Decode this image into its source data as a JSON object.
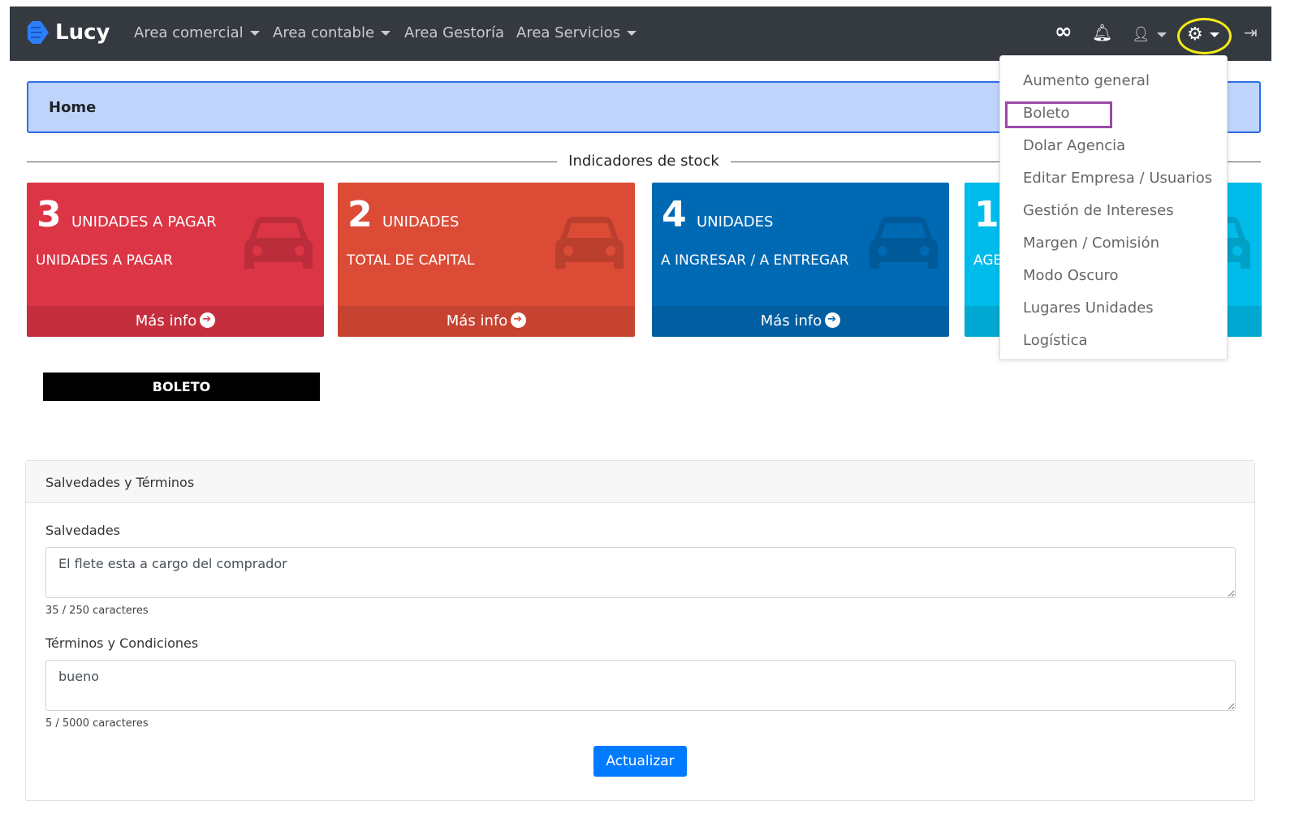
{
  "nav": {
    "brand": "Lucy",
    "items": [
      {
        "label": "Area comercial",
        "dropdown": true
      },
      {
        "label": "Area contable",
        "dropdown": true
      },
      {
        "label": "Area Gestoría",
        "dropdown": false
      },
      {
        "label": "Area Servicios",
        "dropdown": true
      }
    ],
    "icons": [
      "infinity-icon",
      "bell-icon",
      "user-icon",
      "gear-icon",
      "logout-icon"
    ]
  },
  "breadcrumb": {
    "title": "Home"
  },
  "stock": {
    "heading": "Indicadores de stock",
    "cards": [
      {
        "number": "3",
        "title": "UNIDADES A PAGAR",
        "subtitle": "UNIDADES A PAGAR",
        "more": "Más info",
        "color": "#dc3545"
      },
      {
        "number": "2",
        "title": "UNIDADES",
        "subtitle": "TOTAL DE CAPITAL",
        "more": "Más info",
        "color": "#dc4b36"
      },
      {
        "number": "4",
        "title": "UNIDADES",
        "subtitle": "A INGRESAR / A ENTREGAR",
        "more": "Más info",
        "color": "#0069b4"
      },
      {
        "number": "1",
        "title": "",
        "subtitle": "AGE",
        "more": "",
        "color": "#00bcea"
      }
    ]
  },
  "section_title": "BOLETO",
  "form": {
    "header": "Salvedades y Términos",
    "salvedades_label": "Salvedades",
    "salvedades_value": "El flete esta a cargo del comprador",
    "salvedades_count": "35 / 250 caracteres",
    "terminos_label": "Términos y Condiciones",
    "terminos_value": "bueno",
    "terminos_count": "5 / 5000 caracteres",
    "submit": "Actualizar"
  },
  "settings_menu": {
    "items": [
      "Aumento general",
      "Boleto",
      "Dolar Agencia",
      "Editar Empresa / Usuarios",
      "Gestión de Intereses",
      "Margen / Comisión",
      "Modo Oscuro",
      "Lugares Unidades",
      "Logística"
    ],
    "highlighted": "Boleto"
  },
  "annotations": {
    "ring_color": "#f4ec14",
    "highlight_color": "#9b4aa8"
  }
}
